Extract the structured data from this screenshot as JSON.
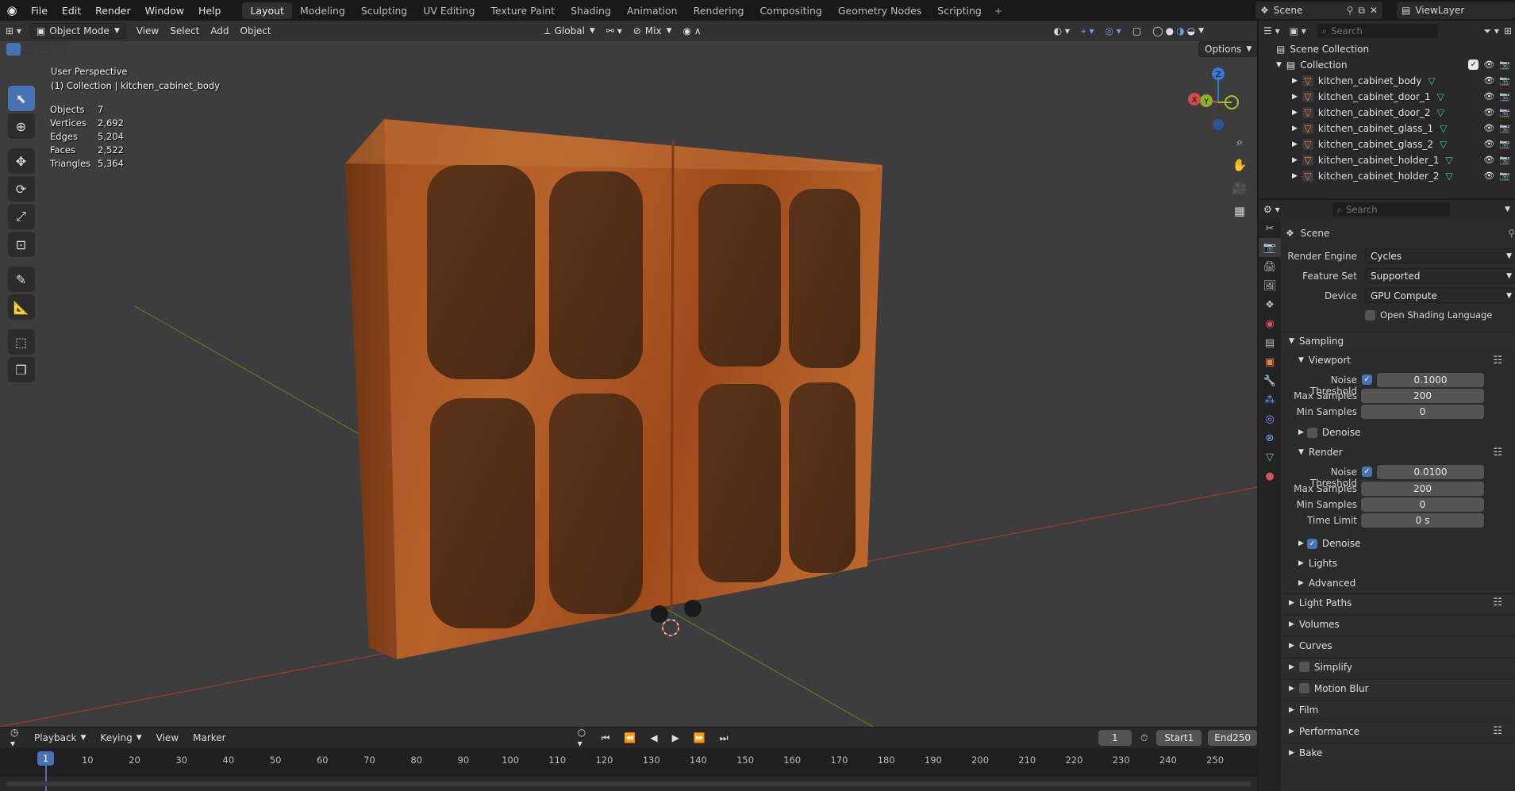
{
  "topbar": {
    "menu": [
      "File",
      "Edit",
      "Render",
      "Window",
      "Help"
    ],
    "workspaces": [
      "Layout",
      "Modeling",
      "Sculpting",
      "UV Editing",
      "Texture Paint",
      "Shading",
      "Animation",
      "Rendering",
      "Compositing",
      "Geometry Nodes",
      "Scripting"
    ],
    "active_workspace": "Layout",
    "scene": "Scene",
    "view_layer": "ViewLayer"
  },
  "viewport": {
    "mode": "Object Mode",
    "menus": [
      "View",
      "Select",
      "Add",
      "Object"
    ],
    "orientation": "Global",
    "pivot": "Mix",
    "options": "Options",
    "perspective": "User Perspective",
    "context": "(1) Collection | kitchen_cabinet_body",
    "stats": [
      {
        "k": "Objects",
        "v": "7"
      },
      {
        "k": "Vertices",
        "v": "2,692"
      },
      {
        "k": "Edges",
        "v": "5,204"
      },
      {
        "k": "Faces",
        "v": "2,522"
      },
      {
        "k": "Triangles",
        "v": "5,364"
      }
    ],
    "gizmo_axes": [
      "Z",
      "Y",
      "X"
    ]
  },
  "timeline": {
    "menus": [
      "Playback",
      "Keying",
      "View",
      "Marker"
    ],
    "current_frame": "1",
    "start_label": "Start",
    "start": "1",
    "end_label": "End",
    "end": "250",
    "ticks": [
      "1",
      "10",
      "20",
      "30",
      "40",
      "50",
      "60",
      "70",
      "80",
      "90",
      "100",
      "110",
      "120",
      "130",
      "140",
      "150",
      "160",
      "170",
      "180",
      "190",
      "200",
      "210",
      "220",
      "230",
      "240",
      "250"
    ]
  },
  "outliner": {
    "search_placeholder": "Search",
    "root": "Scene Collection",
    "collection": "Collection",
    "objects": [
      "kitchen_cabinet_body",
      "kitchen_cabinet_door_1",
      "kitchen_cabinet_door_2",
      "kitchen_cabinet_glass_1",
      "kitchen_cabinet_glass_2",
      "kitchen_cabinet_holder_1",
      "kitchen_cabinet_holder_2"
    ]
  },
  "properties": {
    "search_placeholder": "Search",
    "context": "Scene",
    "render_engine_label": "Render Engine",
    "render_engine": "Cycles",
    "feature_set_label": "Feature Set",
    "feature_set": "Supported",
    "device_label": "Device",
    "device": "GPU Compute",
    "osl_label": "Open Shading Language",
    "sampling": "Sampling",
    "viewport_sect": "Viewport",
    "noise_threshold_label": "Noise Threshold",
    "vp_noise_threshold": "0.1000",
    "max_samples_label": "Max Samples",
    "vp_max_samples": "200",
    "min_samples_label": "Min Samples",
    "vp_min_samples": "0",
    "denoise_label": "Denoise",
    "render_sect": "Render",
    "r_noise_threshold": "0.0100",
    "r_max_samples": "200",
    "r_min_samples": "0",
    "time_limit_label": "Time Limit",
    "r_time_limit": "0 s",
    "lights": "Lights",
    "advanced": "Advanced",
    "panels": [
      "Light Paths",
      "Volumes",
      "Curves",
      "Simplify",
      "Motion Blur",
      "Film",
      "Performance",
      "Bake"
    ]
  }
}
